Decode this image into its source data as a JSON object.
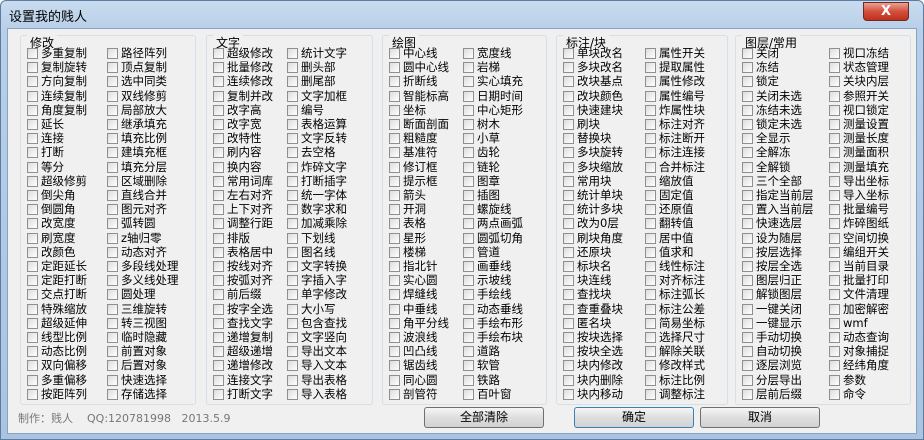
{
  "window": {
    "title": "设置我的贱人",
    "close_label": "X"
  },
  "groups": [
    {
      "title": "修改",
      "columns": [
        [
          "多重复制",
          "复制旋转",
          "方向复制",
          "连续复制",
          "角度复制",
          "延长",
          "连接",
          "打断",
          "等分",
          "超级修剪",
          "倒尖角",
          "倒圆角",
          "改宽度",
          "刷宽度",
          "改颜色",
          "定距延长",
          "定距打断",
          "交点打断",
          "特殊缩放",
          "超级延伸",
          "线型比例",
          "动态比例",
          "双向偏移",
          "多重偏移",
          "按距阵列"
        ],
        [
          "路径阵列",
          "顶点复制",
          "选中同类",
          "双线修剪",
          "局部放大",
          "继承填充",
          "填充比例",
          "建填充框",
          "填充分层",
          "区域删除",
          "直线合并",
          "图元对齐",
          "弧转圆",
          "z轴归零",
          "动态对齐",
          "多段线处理",
          "多义线处理",
          "圆处理",
          "三维旋转",
          "转三视图",
          "临时隐藏",
          "前置对象",
          "后置对象",
          "快速选择",
          "存储选择"
        ]
      ]
    },
    {
      "title": "文字",
      "columns": [
        [
          "超级修改",
          "批量修改",
          "连续修改",
          "复制并改",
          "改字高",
          "改字宽",
          "改特性",
          "刷内容",
          "换内容",
          "常用词库",
          "左右对齐",
          "上下对齐",
          "调整行距",
          "排版",
          "表格居中",
          "按线对齐",
          "按弧对齐",
          "前后缀",
          "按字全选",
          "查找文字",
          "递增复制",
          "超级递增",
          "递增修改",
          "连接文字",
          "打断文字"
        ],
        [
          "统计文字",
          "删头部",
          "删尾部",
          "文字加框",
          "编号",
          "表格运算",
          "文字反转",
          "去空格",
          "炸碎文字",
          "打断插字",
          "统一字体",
          "数字求和",
          "加减乘除",
          "下划线",
          "图名线",
          "文字转换",
          "字插入字",
          "单字修改",
          "大小写",
          "包含查找",
          "文字竖向",
          "导出文本",
          "导入文本",
          "导出表格",
          "导入表格"
        ]
      ]
    },
    {
      "title": "绘图",
      "columns": [
        [
          "中心线",
          "圆中心线",
          "折断线",
          "智能标高",
          "坐标",
          "断面剖面",
          "粗糙度",
          "基准符",
          "修订框",
          "提示框",
          "箭头",
          "开洞",
          "表格",
          "星形",
          "楼梯",
          "指北针",
          "实心圆",
          "焊缝线",
          "中垂线",
          "角平分线",
          "波浪线",
          "凹凸线",
          "锯齿线",
          "同心圆",
          "剖管符"
        ],
        [
          "宽度线",
          "岩梯",
          "实心填充",
          "日期时间",
          "中心矩形",
          "树木",
          "小草",
          "齿轮",
          "链轮",
          "图章",
          "插图",
          "螺旋线",
          "两点画弧",
          "圆弧切角",
          "管道",
          "画垂线",
          "示坡线",
          "手绘线",
          "动态垂线",
          "手绘布形",
          "手绘布块",
          "道路",
          "软管",
          "铁路",
          "百叶窗"
        ]
      ]
    },
    {
      "title": "标注/块",
      "columns": [
        [
          "单块改名",
          "多块改名",
          "改块基点",
          "改块颜色",
          "快速建块",
          "刷块",
          "替换块",
          "多块旋转",
          "多块缩放",
          "常用块",
          "统计单块",
          "统计多块",
          "改为0层",
          "刷块角度",
          "还原块",
          "标块名",
          "块连线",
          "查找块",
          "查重叠块",
          "匿名块",
          "按块选择",
          "按块全选",
          "块内修改",
          "块内删除",
          "块内移动"
        ],
        [
          "属性开关",
          "提取属性",
          "属性修改",
          "属性编号",
          "炸属性块",
          "标注对齐",
          "标注断开",
          "标注连接",
          "合并标注",
          "缩放值",
          "固定值",
          "还原值",
          "翻转值",
          "居中值",
          "值求和",
          "线性标注",
          "对齐标注",
          "标注弧长",
          "标注公差",
          "简易坐标",
          "选择尺寸",
          "解除关联",
          "修改样式",
          "标注比例",
          "调整标注"
        ]
      ]
    },
    {
      "title": "图层/常用",
      "columns": [
        [
          "关闭",
          "冻结",
          "锁定",
          "关闭未选",
          "冻结未选",
          "锁定未选",
          "全显示",
          "全解冻",
          "全解锁",
          "三个全部",
          "指定当前层",
          "置入当前层",
          "快速选层",
          "设为随层",
          "按层选择",
          "按层全选",
          "图层归正",
          "解锁图层",
          "一键关闭",
          "一键显示",
          "手动切换",
          "自动切换",
          "逐层浏览",
          "分层导出",
          "层前后缀"
        ],
        [
          "视口冻结",
          "状态管理",
          "关块内层",
          "参照开关",
          "视口锁定",
          "测量设置",
          "测量长度",
          "测量面积",
          "测量填充",
          "导出坐标",
          "导入坐标",
          "批量编号",
          "炸碎图纸",
          "空间切换",
          "编组开关",
          "当前目录",
          "批量打印",
          "文件清理",
          "加密解密",
          "wmf",
          "动态查询",
          "对象捕捉",
          "经纬角度",
          "参数",
          "命令"
        ]
      ]
    }
  ],
  "footer": {
    "author": "制作：贱人",
    "qq": "QQ:120781998",
    "date": "2013.5.9",
    "buttons": {
      "clear_all": "全部清除",
      "ok": "确定",
      "cancel": "取消"
    }
  }
}
